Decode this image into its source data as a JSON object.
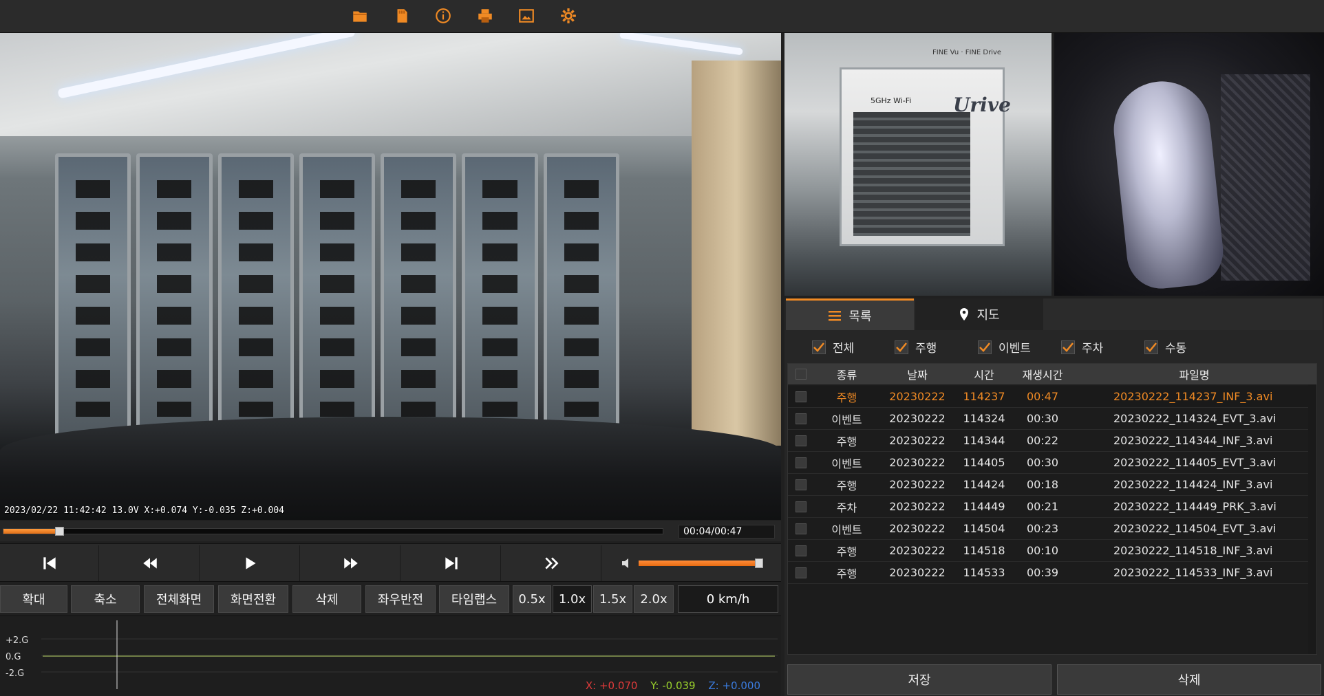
{
  "toolbar": {
    "icons": [
      "folder-icon",
      "sd-card-icon",
      "info-icon",
      "print-icon",
      "capture-icon",
      "settings-icon"
    ],
    "accent": "#f08a24"
  },
  "video": {
    "overlay": "2023/02/22 11:42:42 13.0V X:+0.074 Y:-0.035 Z:+0.004",
    "rear_sign": "Urive",
    "rear_sign_small": "5GHz Wi-Fi",
    "rear_sign_top": "FINE Vu · FINE Drive"
  },
  "playback": {
    "time": "00:04/00:47",
    "progress_fraction": 0.085,
    "volume_fraction": 0.97
  },
  "functions": {
    "zoom_in": "확대",
    "zoom_out": "축소",
    "fullscreen": "전체화면",
    "switch_view": "화면전환",
    "delete": "삭제",
    "mirror": "좌우반전",
    "timelapse": "타임랩스",
    "speeds": [
      "0.5x",
      "1.0x",
      "1.5x",
      "2.0x"
    ],
    "active_speed": "1.0x",
    "speed_readout": "0 km/h"
  },
  "gsensor": {
    "labels": [
      "+2.G",
      "0.G",
      "-2.G"
    ],
    "x": "X: +0.070",
    "y": "Y: -0.039",
    "z": "Z: +0.000",
    "x_color": "#e23b3b",
    "y_color": "#9bd22c",
    "z_color": "#3b7de2"
  },
  "tabs": {
    "list": "목록",
    "map": "지도"
  },
  "filters": [
    "전체",
    "주행",
    "이벤트",
    "주차",
    "수동"
  ],
  "table": {
    "headers": [
      "종류",
      "날짜",
      "시간",
      "재생시간",
      "파일명"
    ],
    "rows": [
      {
        "type": "주행",
        "date": "20230222",
        "time": "114237",
        "duration": "00:47",
        "file": "20230222_114237_INF_3.avi"
      },
      {
        "type": "이벤트",
        "date": "20230222",
        "time": "114324",
        "duration": "00:30",
        "file": "20230222_114324_EVT_3.avi"
      },
      {
        "type": "주행",
        "date": "20230222",
        "time": "114344",
        "duration": "00:22",
        "file": "20230222_114344_INF_3.avi"
      },
      {
        "type": "이벤트",
        "date": "20230222",
        "time": "114405",
        "duration": "00:30",
        "file": "20230222_114405_EVT_3.avi"
      },
      {
        "type": "주행",
        "date": "20230222",
        "time": "114424",
        "duration": "00:18",
        "file": "20230222_114424_INF_3.avi"
      },
      {
        "type": "주차",
        "date": "20230222",
        "time": "114449",
        "duration": "00:21",
        "file": "20230222_114449_PRK_3.avi"
      },
      {
        "type": "이벤트",
        "date": "20230222",
        "time": "114504",
        "duration": "00:23",
        "file": "20230222_114504_EVT_3.avi"
      },
      {
        "type": "주행",
        "date": "20230222",
        "time": "114518",
        "duration": "00:10",
        "file": "20230222_114518_INF_3.avi"
      },
      {
        "type": "주행",
        "date": "20230222",
        "time": "114533",
        "duration": "00:39",
        "file": "20230222_114533_INF_3.avi"
      }
    ]
  },
  "actions": {
    "save": "저장",
    "delete": "삭제"
  }
}
